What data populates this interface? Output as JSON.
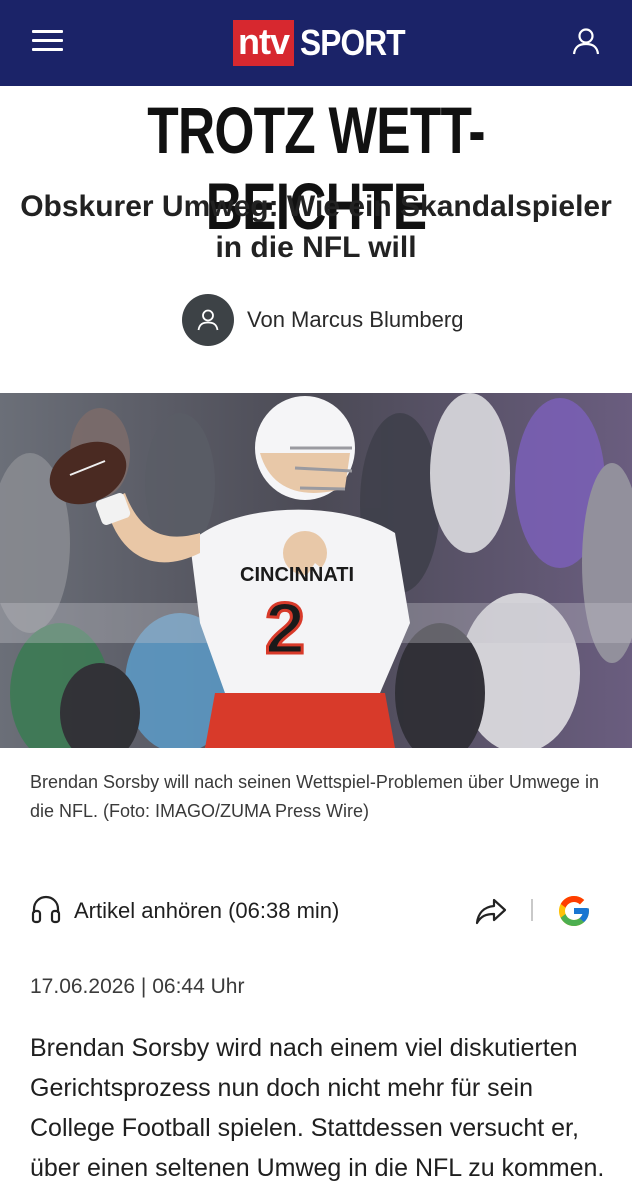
{
  "header": {
    "logo_ntv": "ntv",
    "logo_sport": "SPORT",
    "brand_color": "#1b2368",
    "logo_red": "#d7282f"
  },
  "article": {
    "kicker": "TROTZ WETT-BEICHTE",
    "headline": "Obskurer Umweg: Wie ein Skandalspieler in die NFL will",
    "author": "Von Marcus Blumberg",
    "image_caption": "Brendan Sorsby will nach seinen Wettspiel-Problemen über Umwege in die NFL. (Foto: IMAGO/ZUMA Press Wire)",
    "listen_label": "Artikel anhören (06:38 min)",
    "dateline": "17.06.2026 | 06:44 Uhr",
    "lead": "Brendan Sorsby wird nach einem viel diskutierten Gerichtsprozess nun doch nicht mehr für sein College Football spielen. Stattdessen versucht er, über einen seltenen Umweg in die NFL zu kommen."
  },
  "photo": {
    "jersey_number": "2",
    "jersey_text": "CINCINNATI"
  },
  "icons": {
    "menu": "hamburger-menu-icon",
    "user": "user-icon",
    "avatar": "person-icon",
    "listen": "headphones-icon",
    "share": "share-arrow-icon",
    "google": "google-icon"
  }
}
